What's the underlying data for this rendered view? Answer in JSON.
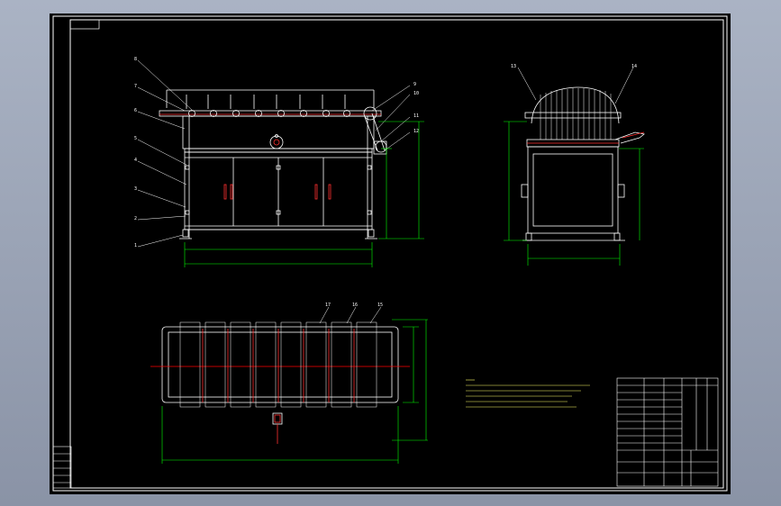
{
  "colors": {
    "frame": "#ffffff",
    "dimension": "#00ff00",
    "leader": "#ffffff",
    "center_line": "#ff0000",
    "accent": "#ff3030",
    "notes": "#ffff66",
    "background": "#000000",
    "workspace": "#8a93a6"
  },
  "front_view": {
    "callouts": [
      "8",
      "7",
      "6",
      "5",
      "4",
      "3",
      "2",
      "1",
      "9",
      "10",
      "11",
      "12"
    ]
  },
  "side_view": {
    "callouts": [
      "13",
      "14"
    ]
  },
  "plan_view": {
    "callouts": [
      "17",
      "16",
      "15"
    ]
  },
  "icons": {
    "handwheel": "handwheel-icon",
    "motor": "motor-icon"
  }
}
